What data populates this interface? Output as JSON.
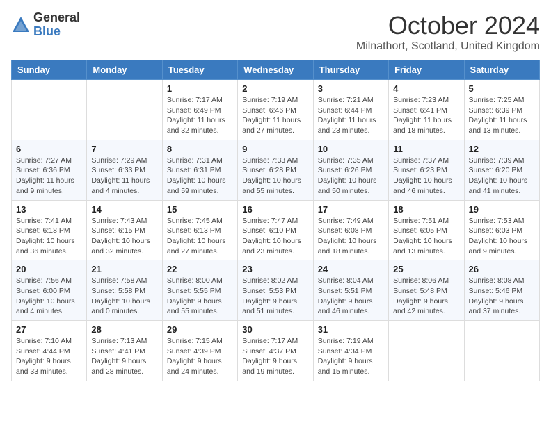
{
  "logo": {
    "general": "General",
    "blue": "Blue"
  },
  "title": {
    "month": "October 2024",
    "location": "Milnathort, Scotland, United Kingdom"
  },
  "weekdays": [
    "Sunday",
    "Monday",
    "Tuesday",
    "Wednesday",
    "Thursday",
    "Friday",
    "Saturday"
  ],
  "weeks": [
    [
      {
        "day": "",
        "info": ""
      },
      {
        "day": "",
        "info": ""
      },
      {
        "day": "1",
        "info": "Sunrise: 7:17 AM\nSunset: 6:49 PM\nDaylight: 11 hours and 32 minutes."
      },
      {
        "day": "2",
        "info": "Sunrise: 7:19 AM\nSunset: 6:46 PM\nDaylight: 11 hours and 27 minutes."
      },
      {
        "day": "3",
        "info": "Sunrise: 7:21 AM\nSunset: 6:44 PM\nDaylight: 11 hours and 23 minutes."
      },
      {
        "day": "4",
        "info": "Sunrise: 7:23 AM\nSunset: 6:41 PM\nDaylight: 11 hours and 18 minutes."
      },
      {
        "day": "5",
        "info": "Sunrise: 7:25 AM\nSunset: 6:39 PM\nDaylight: 11 hours and 13 minutes."
      }
    ],
    [
      {
        "day": "6",
        "info": "Sunrise: 7:27 AM\nSunset: 6:36 PM\nDaylight: 11 hours and 9 minutes."
      },
      {
        "day": "7",
        "info": "Sunrise: 7:29 AM\nSunset: 6:33 PM\nDaylight: 11 hours and 4 minutes."
      },
      {
        "day": "8",
        "info": "Sunrise: 7:31 AM\nSunset: 6:31 PM\nDaylight: 10 hours and 59 minutes."
      },
      {
        "day": "9",
        "info": "Sunrise: 7:33 AM\nSunset: 6:28 PM\nDaylight: 10 hours and 55 minutes."
      },
      {
        "day": "10",
        "info": "Sunrise: 7:35 AM\nSunset: 6:26 PM\nDaylight: 10 hours and 50 minutes."
      },
      {
        "day": "11",
        "info": "Sunrise: 7:37 AM\nSunset: 6:23 PM\nDaylight: 10 hours and 46 minutes."
      },
      {
        "day": "12",
        "info": "Sunrise: 7:39 AM\nSunset: 6:20 PM\nDaylight: 10 hours and 41 minutes."
      }
    ],
    [
      {
        "day": "13",
        "info": "Sunrise: 7:41 AM\nSunset: 6:18 PM\nDaylight: 10 hours and 36 minutes."
      },
      {
        "day": "14",
        "info": "Sunrise: 7:43 AM\nSunset: 6:15 PM\nDaylight: 10 hours and 32 minutes."
      },
      {
        "day": "15",
        "info": "Sunrise: 7:45 AM\nSunset: 6:13 PM\nDaylight: 10 hours and 27 minutes."
      },
      {
        "day": "16",
        "info": "Sunrise: 7:47 AM\nSunset: 6:10 PM\nDaylight: 10 hours and 23 minutes."
      },
      {
        "day": "17",
        "info": "Sunrise: 7:49 AM\nSunset: 6:08 PM\nDaylight: 10 hours and 18 minutes."
      },
      {
        "day": "18",
        "info": "Sunrise: 7:51 AM\nSunset: 6:05 PM\nDaylight: 10 hours and 13 minutes."
      },
      {
        "day": "19",
        "info": "Sunrise: 7:53 AM\nSunset: 6:03 PM\nDaylight: 10 hours and 9 minutes."
      }
    ],
    [
      {
        "day": "20",
        "info": "Sunrise: 7:56 AM\nSunset: 6:00 PM\nDaylight: 10 hours and 4 minutes."
      },
      {
        "day": "21",
        "info": "Sunrise: 7:58 AM\nSunset: 5:58 PM\nDaylight: 10 hours and 0 minutes."
      },
      {
        "day": "22",
        "info": "Sunrise: 8:00 AM\nSunset: 5:55 PM\nDaylight: 9 hours and 55 minutes."
      },
      {
        "day": "23",
        "info": "Sunrise: 8:02 AM\nSunset: 5:53 PM\nDaylight: 9 hours and 51 minutes."
      },
      {
        "day": "24",
        "info": "Sunrise: 8:04 AM\nSunset: 5:51 PM\nDaylight: 9 hours and 46 minutes."
      },
      {
        "day": "25",
        "info": "Sunrise: 8:06 AM\nSunset: 5:48 PM\nDaylight: 9 hours and 42 minutes."
      },
      {
        "day": "26",
        "info": "Sunrise: 8:08 AM\nSunset: 5:46 PM\nDaylight: 9 hours and 37 minutes."
      }
    ],
    [
      {
        "day": "27",
        "info": "Sunrise: 7:10 AM\nSunset: 4:44 PM\nDaylight: 9 hours and 33 minutes."
      },
      {
        "day": "28",
        "info": "Sunrise: 7:13 AM\nSunset: 4:41 PM\nDaylight: 9 hours and 28 minutes."
      },
      {
        "day": "29",
        "info": "Sunrise: 7:15 AM\nSunset: 4:39 PM\nDaylight: 9 hours and 24 minutes."
      },
      {
        "day": "30",
        "info": "Sunrise: 7:17 AM\nSunset: 4:37 PM\nDaylight: 9 hours and 19 minutes."
      },
      {
        "day": "31",
        "info": "Sunrise: 7:19 AM\nSunset: 4:34 PM\nDaylight: 9 hours and 15 minutes."
      },
      {
        "day": "",
        "info": ""
      },
      {
        "day": "",
        "info": ""
      }
    ]
  ]
}
